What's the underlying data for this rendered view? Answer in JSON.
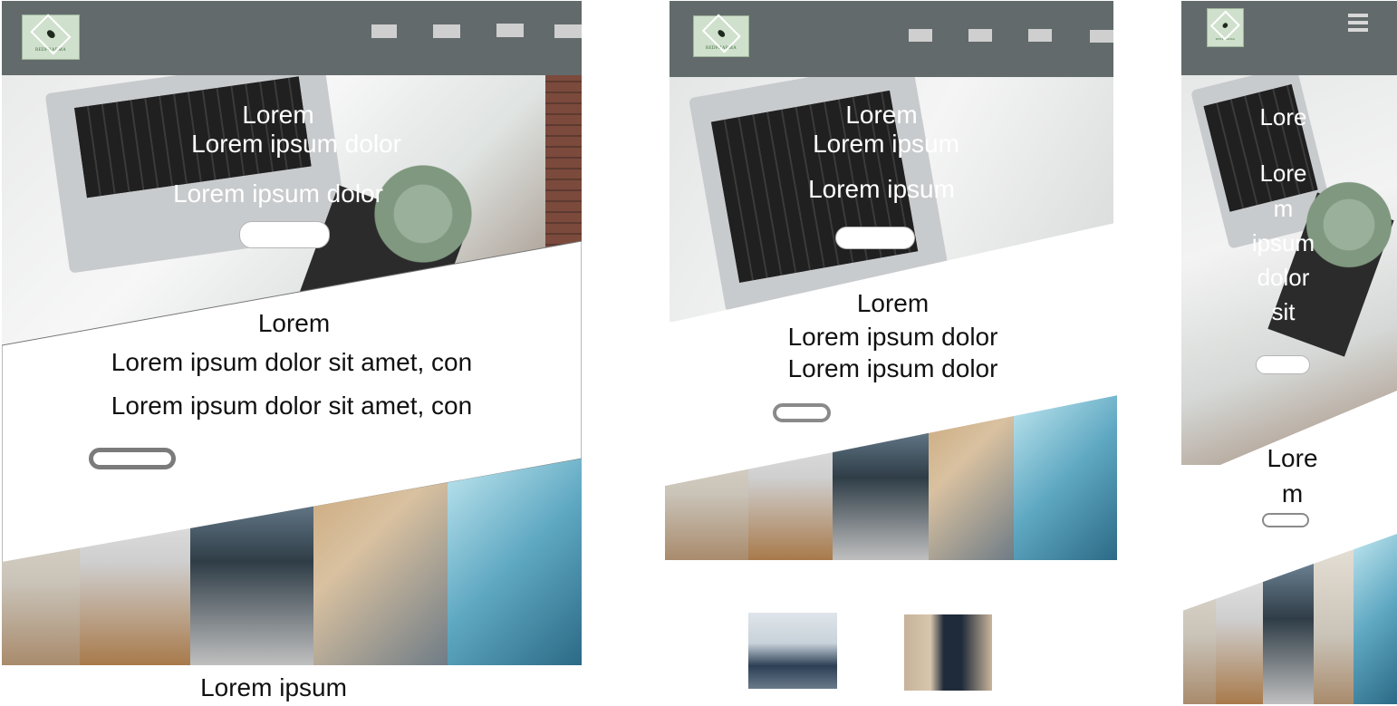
{
  "brand": {
    "logo_text": "REDPHARMA"
  },
  "desktop": {
    "nav": [
      "",
      "",
      "",
      ""
    ],
    "hero_title": "Lorem",
    "hero_line1": "Lorem ipsum dolor",
    "hero_line2": "Lorem ipsum dolor",
    "section_title": "Lorem",
    "section_line1": "Lorem ipsum dolor sit amet, con",
    "section_line2": "Lorem ipsum dolor sit amet, con",
    "footer_title": "Lorem ipsum"
  },
  "tablet": {
    "hero_title": "Lorem",
    "hero_line1": "Lorem ipsum",
    "hero_line2": "Lorem ipsum",
    "section_title": "Lorem",
    "section_line1": "Lorem ipsum dolor",
    "section_line2": "Lorem ipsum dolor"
  },
  "mobile": {
    "hero_title": "Lore",
    "hero_words": [
      "Lore",
      "m",
      "ipsum",
      "dolor",
      "sit"
    ],
    "section_line1": "Lore",
    "section_line2": "m"
  },
  "colors": {
    "header": "#636a6b",
    "nav_item": "#cfcfcf",
    "logo_bg": "#cfe0cc"
  },
  "icons": [
    "hamburger-menu-icon",
    "logo-icon"
  ]
}
